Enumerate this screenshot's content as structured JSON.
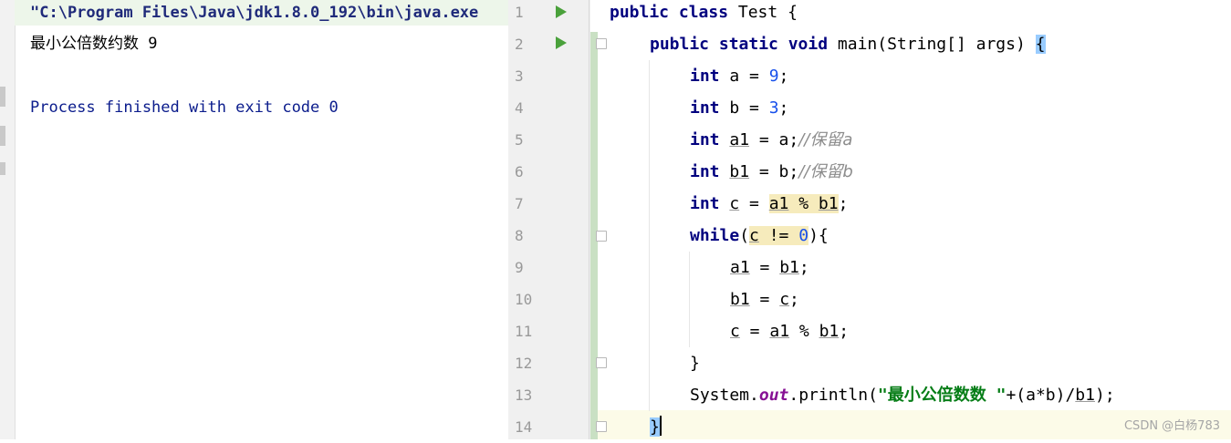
{
  "console": {
    "command": "\"C:\\Program Files\\Java\\jdk1.8.0_192\\bin\\java.exe",
    "output": "最小公倍数约数 9",
    "exit_message": "Process finished with exit code 0"
  },
  "editor": {
    "line_numbers": [
      "1",
      "2",
      "3",
      "4",
      "5",
      "6",
      "7",
      "8",
      "9",
      "10",
      "11",
      "12",
      "13",
      "14"
    ],
    "code": {
      "l1_kw": "public class",
      "l1_rest": " Test {",
      "l2_kw": "public static void",
      "l2_rest": " main(String[] args) ",
      "l2_brace": "{",
      "int_kw": "int",
      "l3_a": " a = ",
      "l3_num": "9",
      "semi": ";",
      "l4_b": " b = ",
      "l4_num": "3",
      "a1": "a1",
      "b1": "b1",
      "c": "c",
      "eq": " = ",
      "l5_rest": " = a;",
      "l5_comment": "//保留a",
      "l6_rest": " = b;",
      "l6_comment": "//保留b",
      "mod": " % ",
      "while_kw": "while",
      "paren_open": "(",
      "neq": " != ",
      "l8_num": "0",
      "l8_end": "){",
      "close_brace": "}",
      "system": "System.",
      "out": "out",
      "println": ".println(",
      "string": "\"最小公倍数数 \"",
      "expr": "+(a*b)/",
      "l13_end": ");",
      "final_brace": "}"
    }
  },
  "watermark": "CSDN @白杨783"
}
